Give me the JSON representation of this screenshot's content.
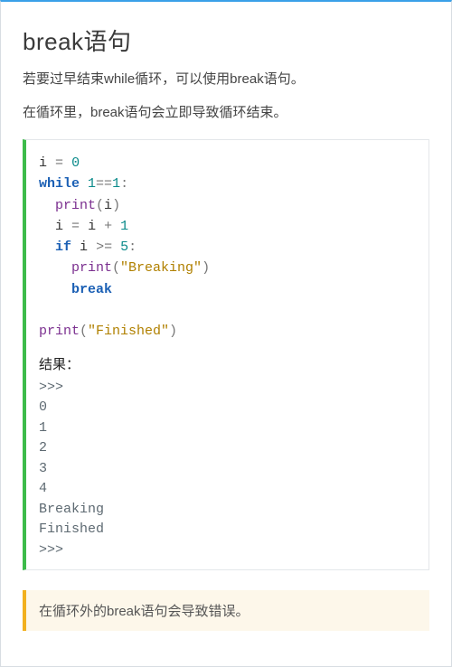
{
  "heading": "break语句",
  "paragraphs": [
    "若要过早结束while循环，可以使用break语句。",
    "在循环里，break语句会立即导致循环结束。"
  ],
  "code": {
    "lines": [
      {
        "indent": 0,
        "tokens": [
          {
            "t": "i",
            "c": "tk-id"
          },
          {
            "t": " ",
            "c": ""
          },
          {
            "t": "=",
            "c": "tk-op"
          },
          {
            "t": " ",
            "c": ""
          },
          {
            "t": "0",
            "c": "tk-teal"
          }
        ]
      },
      {
        "indent": 0,
        "tokens": [
          {
            "t": "while",
            "c": "tk-kw"
          },
          {
            "t": " ",
            "c": ""
          },
          {
            "t": "1",
            "c": "tk-teal"
          },
          {
            "t": "==",
            "c": "tk-op"
          },
          {
            "t": "1",
            "c": "tk-teal"
          },
          {
            "t": ":",
            "c": "tk-op"
          }
        ]
      },
      {
        "indent": 1,
        "tokens": [
          {
            "t": "print",
            "c": "tk-fn"
          },
          {
            "t": "(",
            "c": "tk-op"
          },
          {
            "t": "i",
            "c": "tk-id"
          },
          {
            "t": ")",
            "c": "tk-op"
          }
        ]
      },
      {
        "indent": 1,
        "tokens": [
          {
            "t": "i",
            "c": "tk-id"
          },
          {
            "t": " ",
            "c": ""
          },
          {
            "t": "=",
            "c": "tk-op"
          },
          {
            "t": " ",
            "c": ""
          },
          {
            "t": "i",
            "c": "tk-id"
          },
          {
            "t": " ",
            "c": ""
          },
          {
            "t": "+",
            "c": "tk-op"
          },
          {
            "t": " ",
            "c": ""
          },
          {
            "t": "1",
            "c": "tk-teal"
          }
        ]
      },
      {
        "indent": 1,
        "tokens": [
          {
            "t": "if",
            "c": "tk-kw"
          },
          {
            "t": " ",
            "c": ""
          },
          {
            "t": "i",
            "c": "tk-id"
          },
          {
            "t": " ",
            "c": ""
          },
          {
            "t": ">=",
            "c": "tk-op"
          },
          {
            "t": " ",
            "c": ""
          },
          {
            "t": "5",
            "c": "tk-teal"
          },
          {
            "t": ":",
            "c": "tk-op"
          }
        ]
      },
      {
        "indent": 2,
        "tokens": [
          {
            "t": "print",
            "c": "tk-fn"
          },
          {
            "t": "(",
            "c": "tk-op"
          },
          {
            "t": "\"Breaking\"",
            "c": "tk-str"
          },
          {
            "t": ")",
            "c": "tk-op"
          }
        ]
      },
      {
        "indent": 2,
        "tokens": [
          {
            "t": "break",
            "c": "tk-kw"
          }
        ]
      },
      {
        "indent": 0,
        "tokens": []
      },
      {
        "indent": 0,
        "tokens": [
          {
            "t": "print",
            "c": "tk-fn"
          },
          {
            "t": "(",
            "c": "tk-op"
          },
          {
            "t": "\"Finished\"",
            "c": "tk-str"
          },
          {
            "t": ")",
            "c": "tk-op"
          }
        ]
      }
    ],
    "result_label": "结果：",
    "result_lines": [
      ">>>",
      "0",
      "1",
      "2",
      "3",
      "4",
      "Breaking",
      "Finished",
      ">>>"
    ]
  },
  "note": "在循环外的break语句会导致错误。"
}
